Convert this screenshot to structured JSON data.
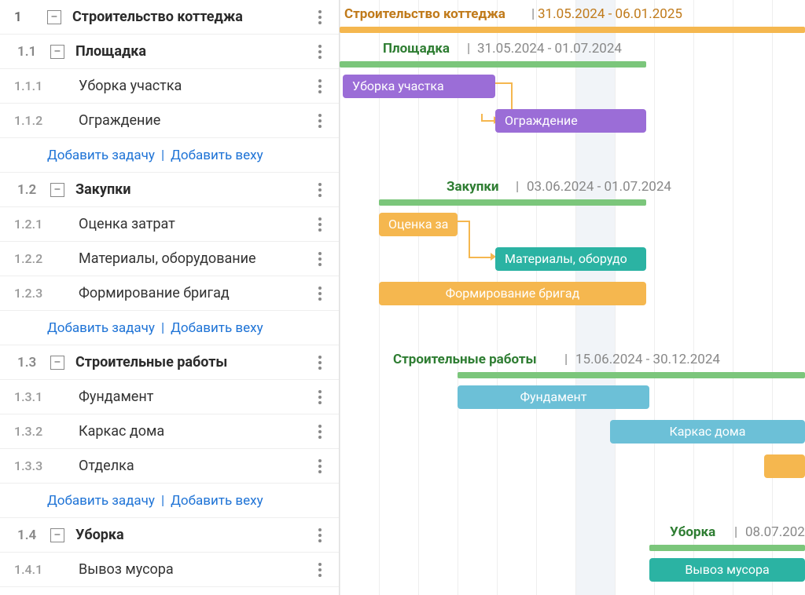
{
  "colors": {
    "orange": "#f5b74f",
    "orange_text": "#c07a1a",
    "green_bar": "#7bc67b",
    "green_text": "#2e7d32",
    "purple": "#9b6dd7",
    "teal": "#2bb3a3",
    "skyblue": "#6cc0d7",
    "link_blue": "#1e73d6"
  },
  "labels": {
    "add_task": "Добавить задачу",
    "add_milestone": "Добавить веху",
    "collapse": "–"
  },
  "project": {
    "wbs": "1",
    "name": "Строительство коттеджа",
    "dates": "31.05.2024 - 06.01.2025"
  },
  "groups": [
    {
      "wbs": "1.1",
      "name": "Площадка",
      "dates": "31.05.2024 - 01.07.2024",
      "tasks": [
        {
          "wbs": "1.1.1",
          "name": "Уборка участка",
          "bar_label": "Уборка участка",
          "color": "purple"
        },
        {
          "wbs": "1.1.2",
          "name": "Ограждение",
          "bar_label": "Ограждение",
          "color": "purple"
        }
      ]
    },
    {
      "wbs": "1.2",
      "name": "Закупки",
      "dates": "03.06.2024 - 01.07.2024",
      "tasks": [
        {
          "wbs": "1.2.1",
          "name": "Оценка затрат",
          "bar_label": "Оценка за",
          "color": "orange"
        },
        {
          "wbs": "1.2.2",
          "name": "Материалы, оборудование",
          "bar_label": "Материалы, оборудо",
          "color": "teal"
        },
        {
          "wbs": "1.2.3",
          "name": "Формирование бригад",
          "bar_label": "Формирование бригад",
          "color": "orange"
        }
      ]
    },
    {
      "wbs": "1.3",
      "name": "Строительные работы",
      "dates": "15.06.2024 - 30.12.2024",
      "tasks": [
        {
          "wbs": "1.3.1",
          "name": "Фундамент",
          "bar_label": "Фундамент",
          "color": "skyblue"
        },
        {
          "wbs": "1.3.2",
          "name": "Каркас дома",
          "bar_label": "Каркас дома",
          "color": "skyblue"
        },
        {
          "wbs": "1.3.3",
          "name": "Отделка",
          "bar_label": "",
          "color": "orange"
        }
      ]
    },
    {
      "wbs": "1.4",
      "name": "Уборка",
      "dates": "08.07.202",
      "tasks": [
        {
          "wbs": "1.4.1",
          "name": "Вывоз мусора",
          "bar_label": "Вывоз мусора",
          "color": "teal"
        }
      ]
    }
  ]
}
